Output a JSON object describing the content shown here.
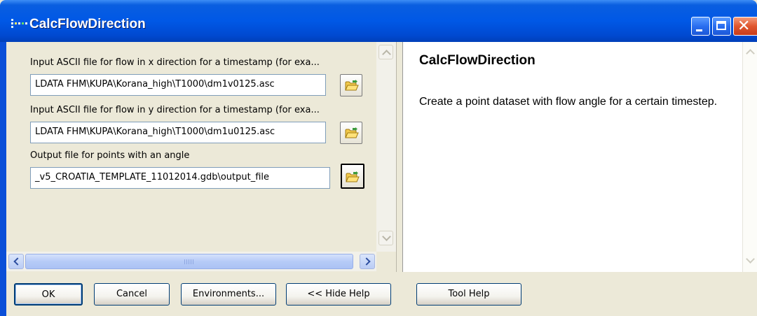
{
  "window": {
    "title": "CalcFlowDirection",
    "icon": "geoprocessing-tool-icon"
  },
  "parameters": [
    {
      "label": "Input ASCII file for flow in x direction for a timestamp (for exa...",
      "value": "LDATA FHM\\KUPA\\Korana_high\\T1000\\dm1v0125.asc"
    },
    {
      "label": "Input ASCII file for flow in y direction for a timestamp (for exa...",
      "value": "LDATA FHM\\KUPA\\Korana_high\\T1000\\dm1u0125.asc"
    },
    {
      "label": "Output file for points with an angle",
      "value": "_v5_CROATIA_TEMPLATE_11012014.gdb\\output_file"
    }
  ],
  "help": {
    "title": "CalcFlowDirection",
    "description": "Create a point dataset with flow angle for a certain timestep."
  },
  "buttons": {
    "ok": "OK",
    "cancel": "Cancel",
    "environments": "Environments...",
    "hide_help": "<< Hide Help",
    "tool_help": "Tool Help"
  },
  "colors": {
    "titlebar": "#0058e6",
    "window_bg": "#ece9d8",
    "help_bg": "#ffffff"
  }
}
